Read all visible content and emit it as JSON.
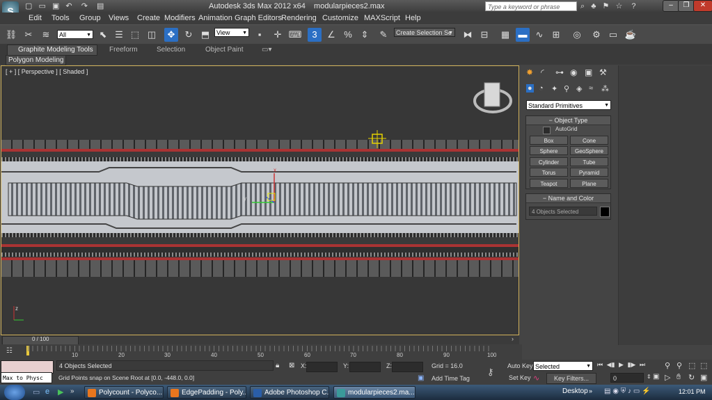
{
  "window": {
    "app_title": "Autodesk 3ds Max  2012 x64",
    "file_name": "modularpieces2.max",
    "search_placeholder": "Type a keyword or phrase"
  },
  "menu": [
    "Edit",
    "Tools",
    "Group",
    "Views",
    "Create",
    "Modifiers",
    "Animation",
    "Graph Editors",
    "Rendering",
    "Customize",
    "MAXScript",
    "Help"
  ],
  "toolbar": {
    "selection_filter": "All",
    "reference_coord": "View",
    "named_selection": "Create Selection Se"
  },
  "ribbon": {
    "tabs": [
      "Graphite Modeling Tools",
      "Freeform",
      "Selection",
      "Object Paint"
    ],
    "subtab": "Polygon Modeling"
  },
  "viewport": {
    "label": "[ + ] [ Perspective ] [ Shaded ]",
    "gizmo_axes": [
      "x",
      "y",
      "z"
    ]
  },
  "command_panel": {
    "category": "Standard Primitives",
    "object_type_header": "Object Type",
    "autogrid_label": "AutoGrid",
    "buttons": [
      "Box",
      "Cone",
      "Sphere",
      "GeoSphere",
      "Cylinder",
      "Tube",
      "Torus",
      "Pyramid",
      "Teapot",
      "Plane"
    ],
    "name_color_header": "Name and Color",
    "name_value": "4 Objects Selected",
    "swatch_color": "#000000"
  },
  "timeline": {
    "frame_display": "0 / 100",
    "ticks": [
      "10",
      "20",
      "30",
      "40",
      "50",
      "60",
      "70",
      "80",
      "90",
      "100"
    ]
  },
  "status": {
    "maxscript_listener": "Max to Physc",
    "selection_info": "4 Objects Selected",
    "prompt": "Grid Points snap on Scene Root at [0.0, -448.0, 0.0]",
    "x_label": "X:",
    "y_label": "Y:",
    "z_label": "Z:",
    "grid": "Grid = 16.0",
    "add_time_tag": "Add Time Tag",
    "auto_key": "Auto Key",
    "set_key": "Set Key",
    "key_mode": "Selected",
    "key_filters": "Key Filters...",
    "current_frame": "0"
  },
  "taskbar": {
    "items": [
      {
        "label": "Polycount - Polyco...",
        "icon_color": "#e8761e"
      },
      {
        "label": "EdgePadding - Poly...",
        "icon_color": "#e8761e"
      },
      {
        "label": "Adobe Photoshop C...",
        "icon_color": "#2a5ea8"
      },
      {
        "label": "modularpieces2.ma...",
        "icon_color": "#3a9a9a"
      }
    ],
    "desktop": "Desktop",
    "clock": "12:01 PM"
  }
}
